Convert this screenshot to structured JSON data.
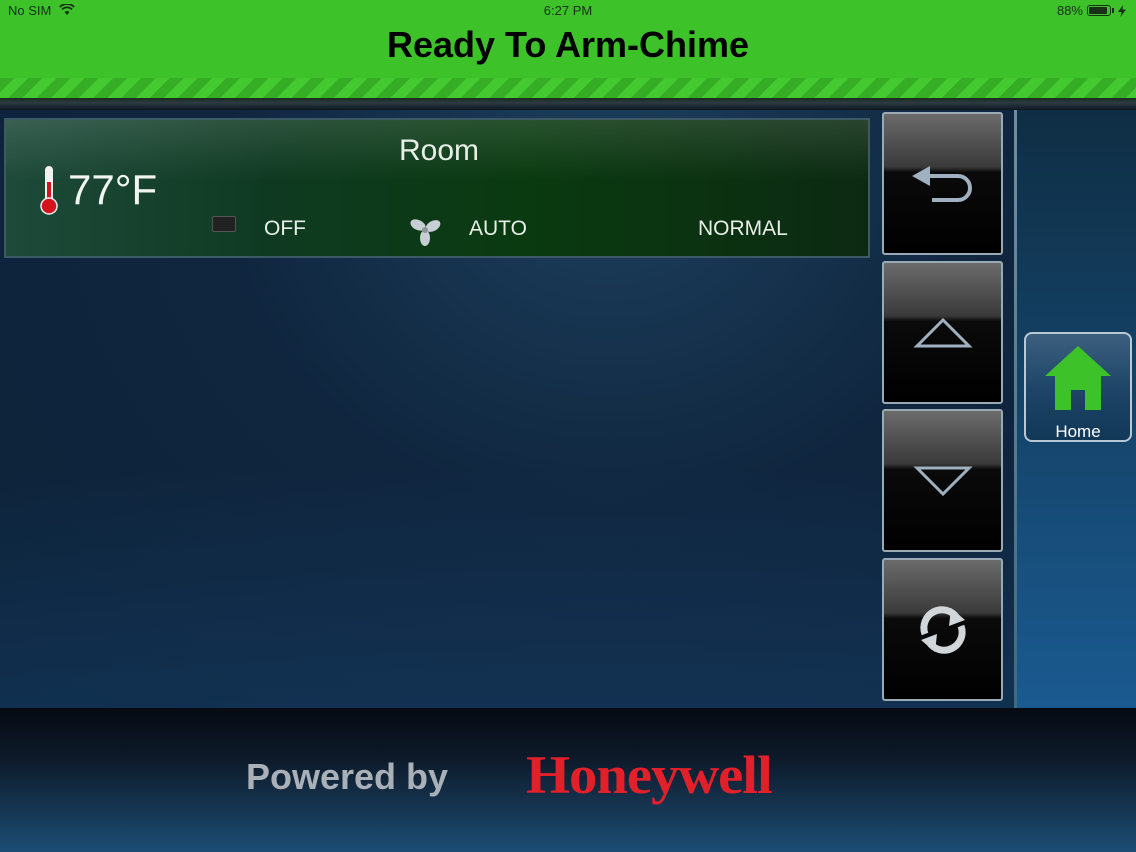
{
  "status_bar": {
    "carrier": "No SIM",
    "time": "6:27 PM",
    "battery": "88%"
  },
  "header": {
    "arm_status": "Ready To Arm-Chime",
    "color": "#3dc22a"
  },
  "thermostat": {
    "name": "Room",
    "temperature": "77°F",
    "system_mode": "OFF",
    "fan_mode": "AUTO",
    "schedule": "NORMAL"
  },
  "nav": {
    "back": "back-icon",
    "up": "arrow-up-icon",
    "down": "arrow-down-icon",
    "refresh": "refresh-icon"
  },
  "home": {
    "label": "Home",
    "icon": "house-icon",
    "color": "#3dc22a"
  },
  "footer": {
    "powered_by": "Powered by",
    "brand": "Honeywell",
    "brand_color": "#e2202a"
  }
}
